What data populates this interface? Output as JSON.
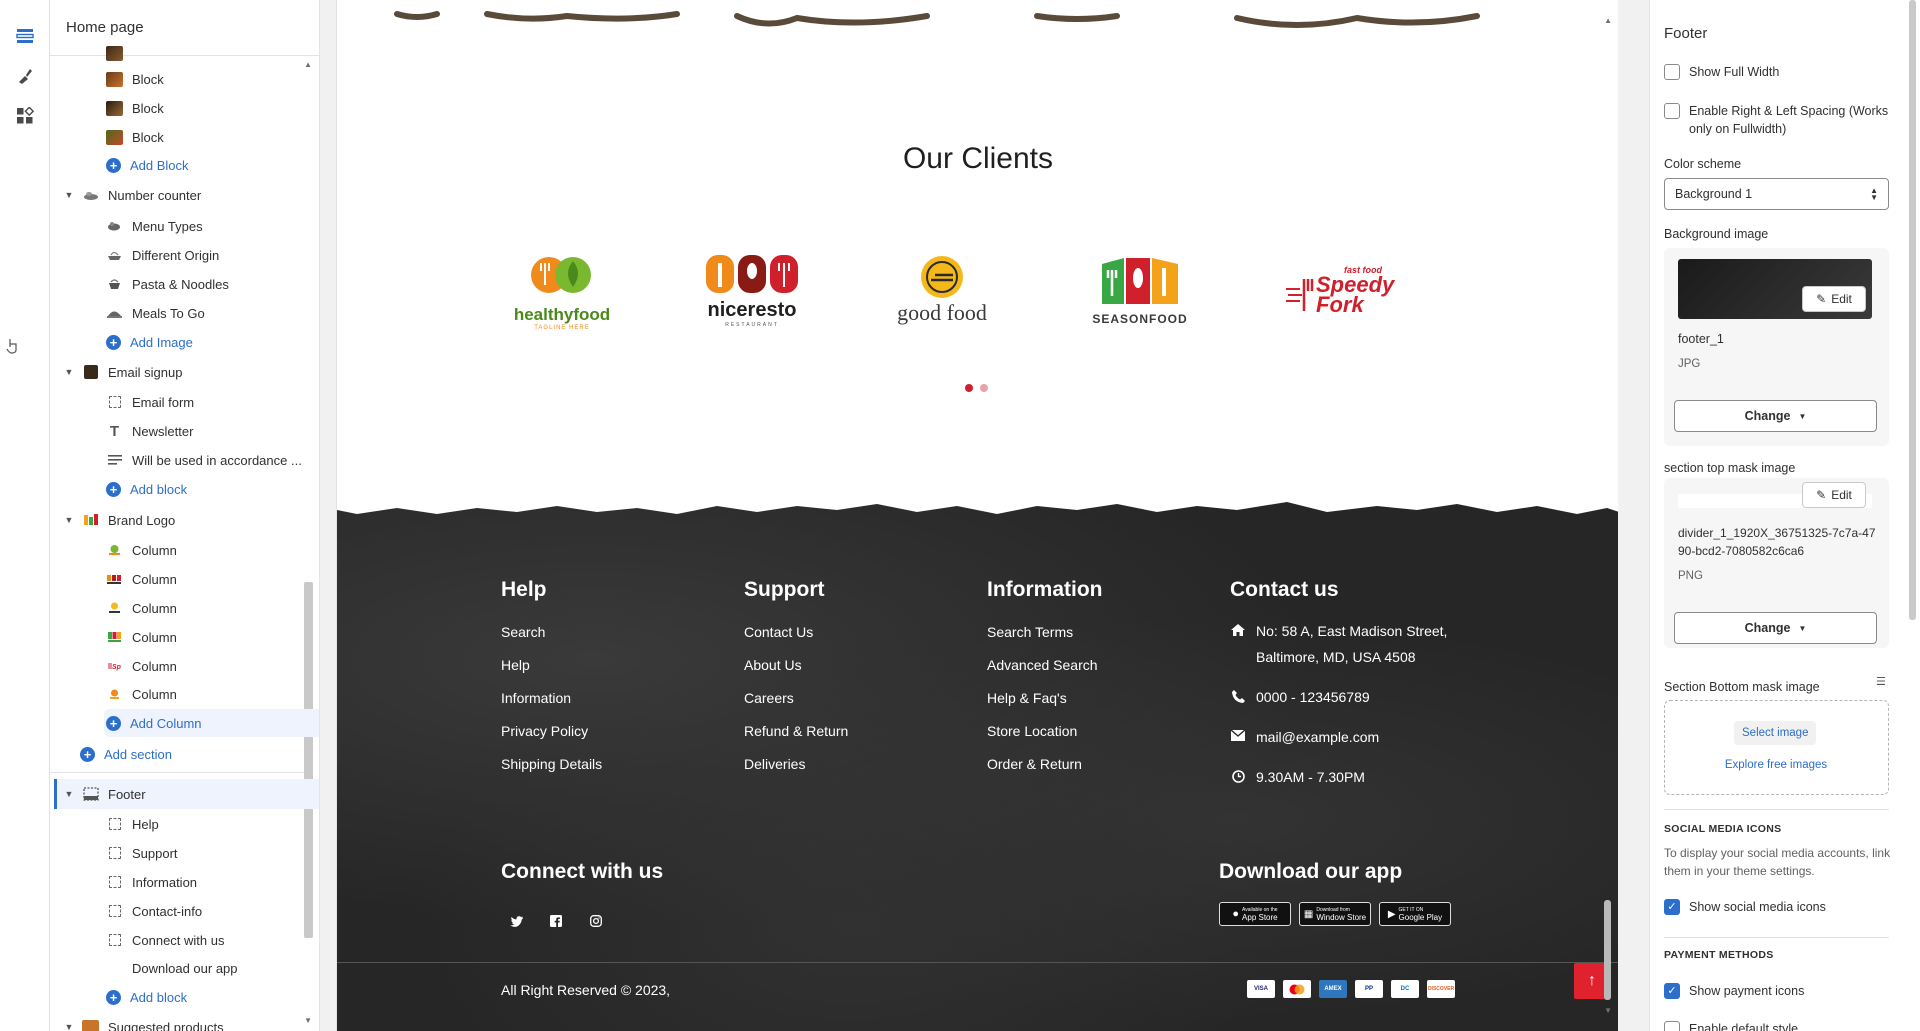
{
  "rail": {
    "icons": [
      "sections-icon",
      "theme-settings-icon",
      "apps-icon"
    ]
  },
  "tree": {
    "title": "Home page",
    "block_rows": [
      "Block",
      "Block",
      "Block"
    ],
    "add_block": "Add Block",
    "number_counter": {
      "title": "Number counter",
      "items": [
        "Menu Types",
        "Different Origin",
        "Pasta & Noodles",
        "Meals To Go"
      ],
      "add": "Add Image"
    },
    "email_signup": {
      "title": "Email signup",
      "items": [
        "Email form",
        "Newsletter",
        "Will be used in accordance ..."
      ],
      "add": "Add block"
    },
    "brand_logo": {
      "title": "Brand Logo",
      "items": [
        "Column",
        "Column",
        "Column",
        "Column",
        "Column",
        "Column"
      ],
      "add": "Add Column"
    },
    "add_section": "Add section",
    "footer": {
      "title": "Footer",
      "items": [
        "Help",
        "Support",
        "Information",
        "Contact-info",
        "Connect with us",
        "Download our app"
      ],
      "add": "Add block"
    },
    "suggested": "Suggested products"
  },
  "preview": {
    "clients_title": "Our Clients",
    "logos": [
      {
        "name": "healthyfood",
        "tag": "TAGLINE HERE"
      },
      {
        "name": "niceresto",
        "tag": "RESTAURANT"
      },
      {
        "name": "good food",
        "tag": ""
      },
      {
        "name": "SEASONFOOD",
        "tag": ""
      },
      {
        "name": "Speedy Fork",
        "tag": "fast food"
      }
    ],
    "footer": {
      "help": {
        "title": "Help",
        "links": [
          "Search",
          "Help",
          "Information",
          "Privacy Policy",
          "Shipping Details"
        ]
      },
      "support": {
        "title": "Support",
        "links": [
          "Contact Us",
          "About Us",
          "Careers",
          "Refund & Return",
          "Deliveries"
        ]
      },
      "information": {
        "title": "Information",
        "links": [
          "Search Terms",
          "Advanced Search",
          "Help & Faq's",
          "Store Location",
          "Order & Return"
        ]
      },
      "contact": {
        "title": "Contact us",
        "address_line1": "No: 58 A, East Madison Street,",
        "address_line2": "Baltimore, MD, USA 4508",
        "phone": "0000 - 123456789",
        "email": "mail@example.com",
        "hours": "9.30AM - 7.30PM"
      },
      "connect_title": "Connect with us",
      "download_title": "Download our app",
      "apps": [
        "App Store",
        "Window Store",
        "Google Play"
      ],
      "app_prefixes": [
        "Available on the",
        "Download from",
        "GET IT ON"
      ],
      "copyright": "All Right Reserved © 2023,",
      "payments": [
        "VISA",
        "MC",
        "AMEX",
        "PP",
        "DC",
        "DISCOVER"
      ]
    }
  },
  "settings": {
    "title": "Footer",
    "show_full_width": "Show Full Width",
    "spacing": "Enable Right & Left Spacing (Works only on Fullwidth)",
    "color_scheme_label": "Color scheme",
    "color_scheme_value": "Background 1",
    "bg_image_label": "Background image",
    "bg_image_name": "footer_1",
    "bg_image_type": "JPG",
    "edit": "Edit",
    "change": "Change",
    "top_mask_label": "section top mask image",
    "top_mask_name": "divider_1_1920X_36751325-7c7a-4790-bcd2-7080582c6ca6",
    "top_mask_type": "PNG",
    "bottom_mask_label": "Section Bottom mask image",
    "select_image": "Select image",
    "explore": "Explore free images",
    "social_heading": "SOCIAL MEDIA ICONS",
    "social_help": "To display your social media accounts, link them in your theme settings.",
    "show_social": "Show social media icons",
    "payment_heading": "PAYMENT METHODS",
    "show_payment": "Show payment icons",
    "default_style": "Enable default style"
  },
  "colors": {
    "accent": "#2c6ecb",
    "dot_active": "#d0202c",
    "dot_inactive": "#e8a3a8",
    "to_top": "#e0212e"
  }
}
